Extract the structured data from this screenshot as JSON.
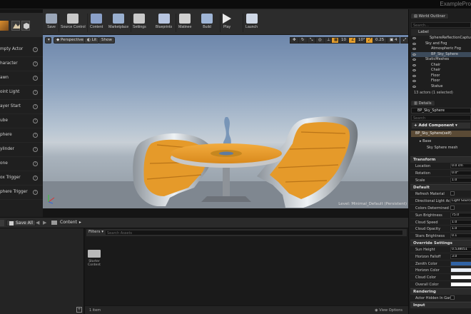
{
  "window": {
    "title": "ExamplePro"
  },
  "toolbar": {
    "buttons": [
      {
        "label": "Save",
        "icon": "save-icon"
      },
      {
        "label": "Source Control",
        "icon": "source-control-icon"
      },
      {
        "label": "Content",
        "icon": "content-icon"
      },
      {
        "label": "Marketplace",
        "icon": "marketplace-icon"
      },
      {
        "label": "Settings",
        "icon": "gear-icon"
      },
      {
        "label": "Blueprints",
        "icon": "blueprints-icon"
      },
      {
        "label": "Matinee",
        "icon": "matinee-icon"
      },
      {
        "label": "Build",
        "icon": "build-icon"
      },
      {
        "label": "Play",
        "icon": "play-icon"
      },
      {
        "label": "Launch",
        "icon": "launch-icon"
      }
    ]
  },
  "place_mode": {
    "items": [
      "mpty Actor",
      "haracter",
      "awn",
      "oint Light",
      "ayer Start",
      "ube",
      "phere",
      "ylinder",
      "one",
      "ox Trigger",
      "phere Trigger"
    ]
  },
  "viewport": {
    "perspective_label": "Perspective",
    "lit_label": "Lit",
    "show_label": "Show",
    "grid_snap": "10",
    "rotation_snap": "10°",
    "scale_snap": "0.25",
    "camera_speed": "4",
    "level_text": "Level:  Minimal_Default (Persistent)"
  },
  "content_browser": {
    "add_new_label": "",
    "save_all_label": "Save All",
    "path_label": "Content",
    "filters_label": "Filters",
    "search_placeholder": "Search Assets",
    "folder_name": "Starter Content",
    "item_count": "1 item",
    "view_options_label": "View Options"
  },
  "world_outliner": {
    "tab_label": "World Outliner",
    "search_placeholder": "Search...",
    "column_label": "Label",
    "rows": [
      {
        "name": "SphereReflectionCapture",
        "indent": 26,
        "selected": false
      },
      {
        "name": "Sky and Fog",
        "indent": 20,
        "selected": false
      },
      {
        "name": "Atmospheric Fog",
        "indent": 28,
        "selected": false
      },
      {
        "name": "BP_Sky_Sphere",
        "indent": 28,
        "selected": true
      },
      {
        "name": "StaticMeshes",
        "indent": 20,
        "selected": false
      },
      {
        "name": "Chair",
        "indent": 28,
        "selected": false
      },
      {
        "name": "Chair",
        "indent": 28,
        "selected": false
      },
      {
        "name": "Floor",
        "indent": 28,
        "selected": false
      },
      {
        "name": "Floor",
        "indent": 28,
        "selected": false
      },
      {
        "name": "Statue",
        "indent": 28,
        "selected": false
      }
    ],
    "footer": "13 actors (1 selected)"
  },
  "details": {
    "tab_label": "Details",
    "actor_name": "BP_Sky_Sphere",
    "search_placeholder": "Search",
    "add_component_label": "+ Add Component",
    "self_label": "BP_Sky_Sphere(self)",
    "base_label": "Base",
    "mesh_label": "Sky Sphere mesh",
    "transform_header": "Transform",
    "transform": [
      {
        "label": "Location",
        "value": "0.0 cm"
      },
      {
        "label": "Rotation",
        "value": "0.0°"
      },
      {
        "label": "Scale",
        "value": "1.0"
      }
    ],
    "default_header": "Default",
    "default_props": [
      {
        "label": "Refresh Material",
        "kind": "check"
      },
      {
        "label": "Directional Light Actor",
        "kind": "value",
        "value": "Light Source"
      },
      {
        "label": "Colors Determined By",
        "kind": "check"
      },
      {
        "label": "Sun Brightness",
        "kind": "value",
        "value": "75.0"
      },
      {
        "label": "Cloud Speed",
        "kind": "value",
        "value": "1.0"
      },
      {
        "label": "Cloud Opacity",
        "kind": "value",
        "value": "1.0"
      },
      {
        "label": "Stars Brightness",
        "kind": "value",
        "value": "0.1"
      }
    ],
    "override_header": "Override Settings",
    "override_props": [
      {
        "label": "Sun Height",
        "kind": "value",
        "value": "0.538051"
      },
      {
        "label": "Horizon Falloff",
        "kind": "value",
        "value": "3.0"
      },
      {
        "label": "Zenith Color",
        "kind": "color",
        "color": "#2f63a6"
      },
      {
        "label": "Horizon Color",
        "kind": "color",
        "color": "#e8eef6"
      },
      {
        "label": "Cloud Color",
        "kind": "color",
        "color": "#ffffff"
      },
      {
        "label": "Overall Color",
        "kind": "color",
        "color": "#ffffff"
      }
    ],
    "rendering_header": "Rendering",
    "rendering_props": [
      {
        "label": "Actor Hidden In Game",
        "kind": "check"
      }
    ],
    "input_header": "Input"
  },
  "colors": {
    "accent": "#e49e2d",
    "selection": "#3c4a5a",
    "chair_seat": "#e59a2a",
    "table_top": "#f0a030"
  }
}
